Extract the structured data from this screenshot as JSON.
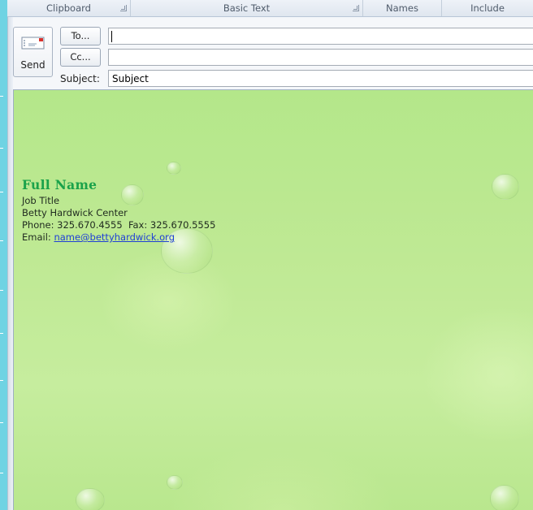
{
  "ribbon": {
    "groups": [
      {
        "label": "Clipboard"
      },
      {
        "label": "Basic Text"
      },
      {
        "label": "Names"
      },
      {
        "label": "Include"
      }
    ]
  },
  "compose": {
    "send_label": "Send",
    "to_button": "To...",
    "cc_button": "Cc...",
    "subject_label": "Subject:",
    "to_value": "",
    "cc_value": "",
    "subject_value": "Subject"
  },
  "signature": {
    "name": "Full Name",
    "job_title": "Job Title",
    "organization": "Betty Hardwick Center",
    "phone_label": "Phone:",
    "phone": "325.670.4555",
    "fax_label": "Fax:",
    "fax": "325.670.5555",
    "email_label": "Email:",
    "email": "name@bettyhardwick.org"
  },
  "colors": {
    "accent_name": "#1aa24a",
    "link": "#1f3fd6",
    "body_background": "#bde893"
  },
  "icons": {
    "send": "envelope-send-icon",
    "launcher": "dialog-launcher-icon"
  }
}
